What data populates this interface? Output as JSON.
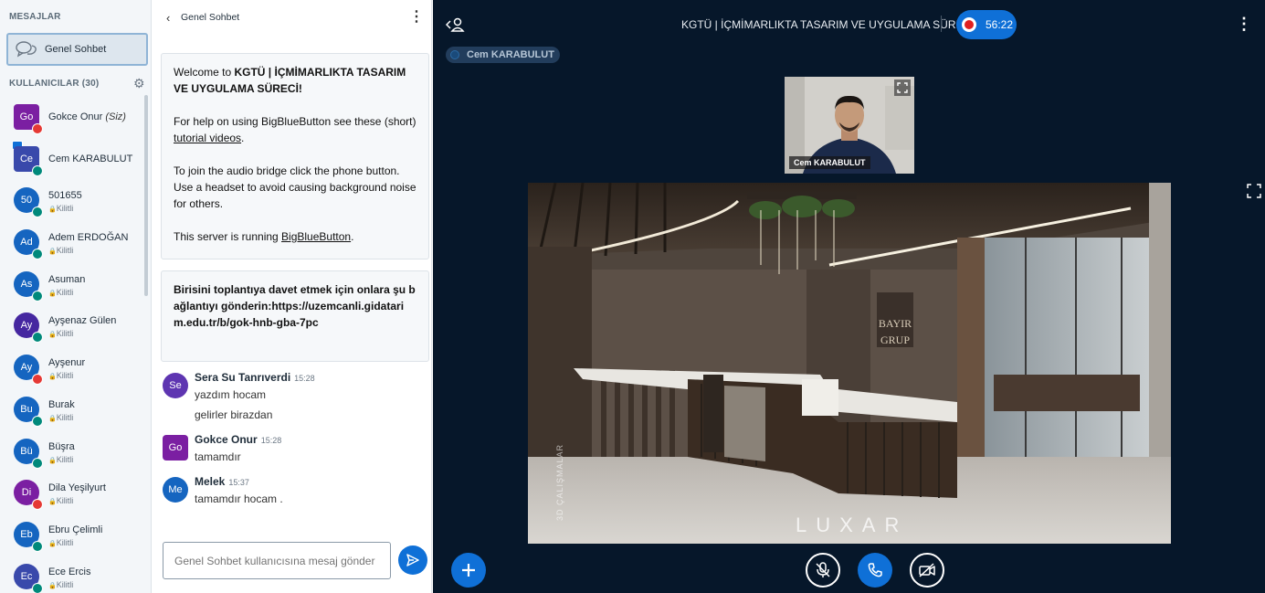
{
  "sidebar": {
    "messages_title": "MESAJLAR",
    "public_chat_label": "Genel Sohbet",
    "users_title": "KULLANICILAR (30)",
    "users": [
      {
        "initials": "Go",
        "name": "Gokce Onur",
        "suffix": "(Siz)",
        "status": "",
        "color": "#7b1fa2",
        "mic": "muted"
      },
      {
        "initials": "Ce",
        "name": "Cem KARABULUT",
        "suffix": "",
        "status": "",
        "color": "#3949ab",
        "mic": "active",
        "presenter": true
      },
      {
        "initials": "50",
        "name": "501655",
        "suffix": "",
        "status": "Kilitli",
        "color": "#1565c0",
        "mic": "listen"
      },
      {
        "initials": "Ad",
        "name": "Adem ERDOĞAN",
        "suffix": "",
        "status": "Kilitli",
        "color": "#1565c0",
        "mic": "listen"
      },
      {
        "initials": "As",
        "name": "Asuman",
        "suffix": "",
        "status": "Kilitli",
        "color": "#1565c0",
        "mic": "listen"
      },
      {
        "initials": "Ay",
        "name": "Ayşenaz Gülen",
        "suffix": "",
        "status": "Kilitli",
        "color": "#4527a0",
        "mic": "listen"
      },
      {
        "initials": "Ay",
        "name": "Ayşenur",
        "suffix": "",
        "status": "Kilitli",
        "color": "#1565c0",
        "mic": "muted"
      },
      {
        "initials": "Bu",
        "name": "Burak",
        "suffix": "",
        "status": "Kilitli",
        "color": "#1565c0",
        "mic": "listen"
      },
      {
        "initials": "Bü",
        "name": "Büşra",
        "suffix": "",
        "status": "Kilitli",
        "color": "#1565c0",
        "mic": "listen"
      },
      {
        "initials": "Di",
        "name": "Dila Yeşilyurt",
        "suffix": "",
        "status": "Kilitli",
        "color": "#7b1fa2",
        "mic": "muted"
      },
      {
        "initials": "Eb",
        "name": "Ebru Çelimli",
        "suffix": "",
        "status": "Kilitli",
        "color": "#1565c0",
        "mic": "listen"
      },
      {
        "initials": "Ec",
        "name": "Ece Ercis",
        "suffix": "",
        "status": "Kilitli",
        "color": "#3949ab",
        "mic": "listen"
      }
    ]
  },
  "chat": {
    "title": "Genel Sohbet",
    "welcome": {
      "l1_pre": "Welcome to ",
      "l1_bold": "KGTÜ | İÇMİMARLIKTA TASARIM VE UYGULAMA SÜRECİ",
      "l1_post": "!",
      "l2_pre": "For help on using BigBlueButton see these (short) ",
      "l2_link": "tutorial videos",
      "l2_post": ".",
      "l3": "To join the audio bridge click the phone button. Use a headset to avoid causing background noise for others.",
      "l4_pre": "This server is running ",
      "l4_link": "BigBlueButton",
      "l4_post": "."
    },
    "invite": "Birisini toplantıya davet etmek için onlara şu bağlantıyı gönderin:https://uzemcanli.gidatarim.edu.tr/b/gok-hnb-gba-7pc",
    "messages": [
      {
        "initials": "Se",
        "color": "#5e35b1",
        "sender": "Sera Su Tanrıverdi",
        "time": "15:28",
        "lines": [
          "yazdım hocam",
          "gelirler birazdan"
        ]
      },
      {
        "initials": "Go",
        "color": "#7b1fa2",
        "sender": "Gokce Onur",
        "time": "15:28",
        "lines": [
          "tamamdır"
        ]
      },
      {
        "initials": "Me",
        "color": "#1565c0",
        "sender": "Melek",
        "time": "15:37",
        "lines": [
          "tamamdır hocam ."
        ]
      }
    ],
    "input_placeholder": "Genel Sohbet kullanıcısına mesaj gönder"
  },
  "main": {
    "meeting_title": "KGTÜ | İÇMİMARLIKTA TASARIM VE UYGULAMA SÜRECİ",
    "recording_time": "56:22",
    "talking_user": "Cem KARABULUT",
    "webcam_name": "Cem KARABULUT",
    "slide_logo": "LUXAR",
    "slide_vertical": "3D ÇALIŞMALAR",
    "slide_sign": "BAYIR GRUP"
  },
  "colors": {
    "accent": "#0f70d7",
    "main_bg": "#06172a",
    "muted_red": "#e53935",
    "listen_green": "#00897b"
  }
}
